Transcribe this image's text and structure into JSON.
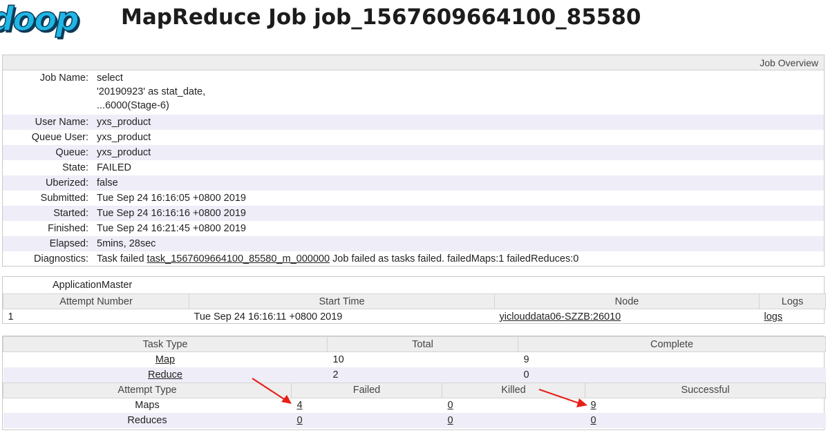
{
  "header": {
    "logo_text": "doop",
    "title": "MapReduce Job job_1567609664100_85580"
  },
  "overview": {
    "section_title": "Job Overview",
    "rows": {
      "job_name": {
        "label": "Job Name:",
        "lines": [
          "select",
          "'20190923' as stat_date,",
          "...6000(Stage-6)"
        ]
      },
      "user_name": {
        "label": "User Name:",
        "value": "yxs_product"
      },
      "queue_user": {
        "label": "Queue User:",
        "value": "yxs_product"
      },
      "queue": {
        "label": "Queue:",
        "value": "yxs_product"
      },
      "state": {
        "label": "State:",
        "value": "FAILED"
      },
      "uberized": {
        "label": "Uberized:",
        "value": "false"
      },
      "submitted": {
        "label": "Submitted:",
        "value": "Tue Sep 24 16:16:05 +0800 2019"
      },
      "started": {
        "label": "Started:",
        "value": "Tue Sep 24 16:16:16 +0800 2019"
      },
      "finished": {
        "label": "Finished:",
        "value": "Tue Sep 24 16:21:45 +0800 2019"
      },
      "elapsed": {
        "label": "Elapsed:",
        "value": "5mins, 28sec"
      },
      "diagnostics": {
        "label": "Diagnostics:",
        "prefix": "Task failed ",
        "task_link": "task_1567609664100_85580_m_000000",
        "suffix": " Job failed as tasks failed. failedMaps:1 failedReduces:0"
      }
    }
  },
  "application_master": {
    "title": "ApplicationMaster",
    "columns": [
      "Attempt Number",
      "Start Time",
      "Node",
      "Logs"
    ],
    "row": {
      "attempt": "1",
      "start_time": "Tue Sep 24 16:16:11 +0800 2019",
      "node": "yiclouddata06-SZZB:26010",
      "logs": "logs"
    }
  },
  "tasks": {
    "task_columns": [
      "Task Type",
      "Total",
      "Complete"
    ],
    "task_rows": [
      {
        "type": "Map",
        "total": "10",
        "complete": "9"
      },
      {
        "type": "Reduce",
        "total": "2",
        "complete": "0"
      }
    ],
    "attempt_columns": [
      "Attempt Type",
      "Failed",
      "Killed",
      "Successful"
    ],
    "attempt_rows": [
      {
        "type": "Maps",
        "failed": "4",
        "killed": "0",
        "successful": "9"
      },
      {
        "type": "Reduces",
        "failed": "0",
        "killed": "0",
        "successful": "0"
      }
    ]
  },
  "colors": {
    "logo": "#1fb7e6",
    "row_alt": "#efedf8",
    "header_bg": "#eeeeee",
    "annotation_arrow": "#e8201a"
  },
  "icons": [
    "red-arrow-annotation-icon"
  ]
}
